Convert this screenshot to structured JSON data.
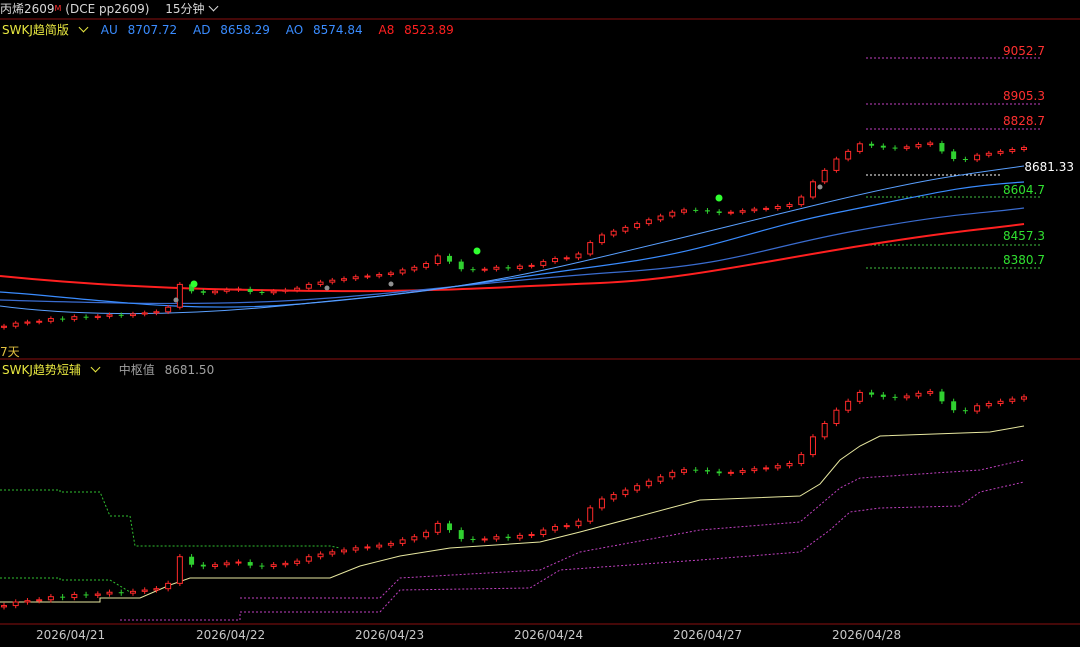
{
  "header": {
    "symbol": "丙烯2609",
    "superscript": "M",
    "code": "(DCE pp2609)",
    "period": "15分钟"
  },
  "main_indicator": {
    "name": "SWKJ趋简版",
    "values": [
      {
        "label": "AU",
        "value": "8707.72",
        "color": "#3a8cff"
      },
      {
        "label": "AD",
        "value": "8658.29",
        "color": "#3a8cff"
      },
      {
        "label": "AO",
        "value": "8574.84",
        "color": "#3a8cff"
      },
      {
        "label": "A8",
        "value": "8523.89",
        "color": "#ff2020"
      }
    ]
  },
  "sub_indicator": {
    "name": "SWKJ趋势短辅",
    "mid_label": "中枢值",
    "mid_value": "8681.50"
  },
  "price_levels": [
    {
      "value": "9052.7",
      "color": "#ff3030"
    },
    {
      "value": "8905.3",
      "color": "#ff3030"
    },
    {
      "value": "8828.7",
      "color": "#ff3030"
    },
    {
      "value": "8681.33",
      "color": "#ffffff"
    },
    {
      "value": "8604.7",
      "color": "#30e030"
    },
    {
      "value": "8457.3",
      "color": "#30e030"
    },
    {
      "value": "8380.7",
      "color": "#30e030"
    }
  ],
  "left_tag": "7天",
  "dates": [
    "2026/04/21",
    "2026/04/22",
    "2026/04/23",
    "2026/04/24",
    "2026/04/27",
    "2026/04/28"
  ],
  "colors": {
    "background": "#000000",
    "up_candle": "#ff2a2a",
    "down_candle": "#30d030",
    "panel_border": "#8a1010",
    "line_au": "#3a8cff",
    "line_a8": "#ff2020",
    "support_line": "#e8e8a0",
    "band_line": "#c040c0"
  },
  "chart_data": {
    "type": "candlestick",
    "price_closes": [
      8420,
      8428,
      8431,
      8433,
      8440,
      8438,
      8445,
      8443,
      8446,
      8450,
      8448,
      8452,
      8455,
      8458,
      8470,
      8530,
      8512,
      8508,
      8512,
      8516,
      8518,
      8510,
      8508,
      8512,
      8515,
      8520,
      8530,
      8536,
      8541,
      8545,
      8550,
      8552,
      8556,
      8560,
      8568,
      8575,
      8585,
      8605,
      8590,
      8570,
      8568,
      8570,
      8575,
      8572,
      8578,
      8580,
      8590,
      8598,
      8600,
      8610,
      8640,
      8660,
      8670,
      8680,
      8690,
      8700,
      8710,
      8720,
      8726,
      8725,
      8722,
      8718,
      8720,
      8724,
      8728,
      8730,
      8735,
      8740,
      8760,
      8800,
      8830,
      8860,
      8880,
      8900,
      8895,
      8890,
      8888,
      8892,
      8898,
      8902,
      8880,
      8860,
      8858,
      8870,
      8875,
      8880,
      8885,
      8890
    ]
  }
}
